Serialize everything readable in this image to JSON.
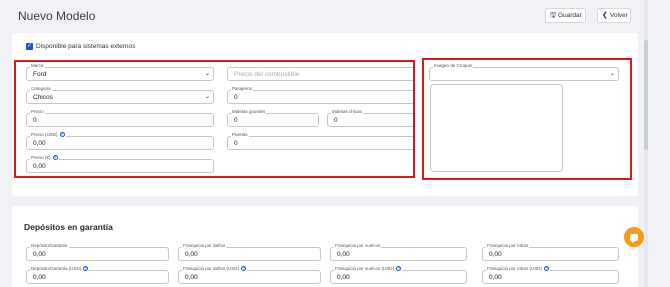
{
  "header": {
    "title": "Nuevo Modelo",
    "save_label": "Guardar",
    "back_label": "Volver"
  },
  "form": {
    "external_checkbox_label": "Disponible para sistemas externos",
    "external_checked": true,
    "marca": {
      "label": "Marca",
      "value": "Ford"
    },
    "combustible": {
      "placeholder": "Precio del combustible"
    },
    "categoria": {
      "label": "Categoría",
      "value": "Chicos"
    },
    "pasajeros": {
      "label": "Pasajeros",
      "value": "0"
    },
    "precio": {
      "label": "Precio",
      "value": "0"
    },
    "maletas_grandes": {
      "label": "Maletas grandes",
      "value": "0"
    },
    "maletas_chicas": {
      "label": "Maletas chicas",
      "value": "0"
    },
    "precio_usd": {
      "label": "Precio (USD)",
      "value": "0,00"
    },
    "puertas": {
      "label": "Puertas",
      "value": "0"
    },
    "precio_eur": {
      "label": "Precio (€)",
      "value": "0,00"
    },
    "croquis": {
      "label": "Imagen de Croquis",
      "value": ""
    }
  },
  "deposits": {
    "title": "Depósitos en garantía",
    "row1": [
      {
        "label": "Depósito/Garantía",
        "value": "0,00"
      },
      {
        "label": "Franquicia por daños",
        "value": "0,00"
      },
      {
        "label": "Franquicia por vuelcos",
        "value": "0,00"
      },
      {
        "label": "Franquicia por robos",
        "value": "0,00"
      }
    ],
    "row2": [
      {
        "label": "Depósito/Garantía (USD)",
        "value": "0,00"
      },
      {
        "label": "Franquicia por daños (USD)",
        "value": "0,00"
      },
      {
        "label": "Franquicia por vuelcos (USD)",
        "value": "0,00"
      },
      {
        "label": "Franquicia por robos (USD)",
        "value": "0,00"
      }
    ]
  },
  "colors": {
    "accent": "#1f57c4",
    "highlight_border": "#d71a20",
    "chat_button": "#f59a1b"
  },
  "icons": {
    "save": "save-icon",
    "back": "chevron-left-icon",
    "help": "question-circle-icon",
    "chat": "chat-icon"
  }
}
